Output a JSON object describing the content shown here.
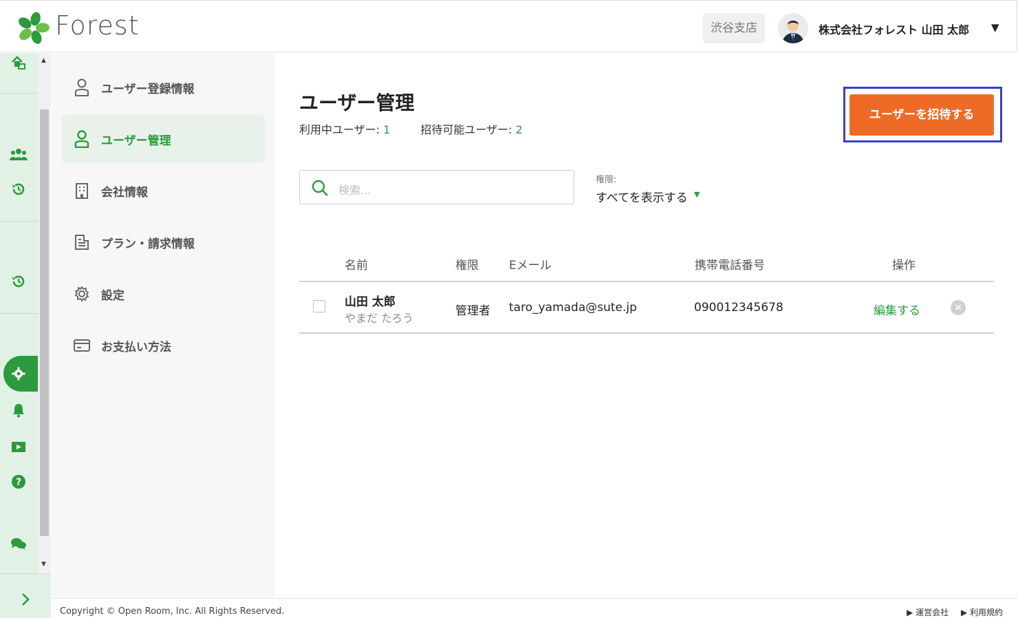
{
  "header": {
    "logo_text": "Forest",
    "branch": "渋谷支店",
    "user": "株式会社フォレスト 山田 太郎",
    "caret": "▼"
  },
  "subnav": {
    "items": [
      {
        "label": "ユーザー登録情報",
        "icon": "person-icon"
      },
      {
        "label": "ユーザー管理",
        "icon": "person-icon",
        "active": true
      },
      {
        "label": "会社情報",
        "icon": "building-icon"
      },
      {
        "label": "プラン・請求情報",
        "icon": "invoice-icon"
      },
      {
        "label": "設定",
        "icon": "gear-icon"
      },
      {
        "label": "お支払い方法",
        "icon": "credit-card-icon"
      }
    ]
  },
  "main": {
    "title": "ユーザー管理",
    "active_users_label": "利用中ユーザー: ",
    "active_users_value": "1",
    "invitable_label": "招待可能ユーザー: ",
    "invitable_value": "2",
    "invite_button": "ユーザーを招待する",
    "search_placeholder": "検索...",
    "filter_label": "権限:",
    "filter_value": "すべてを表示する",
    "columns": [
      "名前",
      "権限",
      "Eメール",
      "携帯電話番号",
      "操作"
    ],
    "rows": [
      {
        "name": "山田 太郎",
        "kana": "やまだ たろう",
        "role": "管理者",
        "email": "taro_yamada@sute.jp",
        "phone": "090012345678",
        "action": "編集する"
      }
    ]
  },
  "footer": {
    "copyright": "Copyright © Open Room, Inc. All Rights Reserved.",
    "links": [
      "▶ 運営会社",
      "▶ 利用規約"
    ]
  },
  "colors": {
    "brand_green": "#2c9a3d",
    "accent_orange": "#ef6b25",
    "highlight_frame": "#3b3fc4"
  }
}
